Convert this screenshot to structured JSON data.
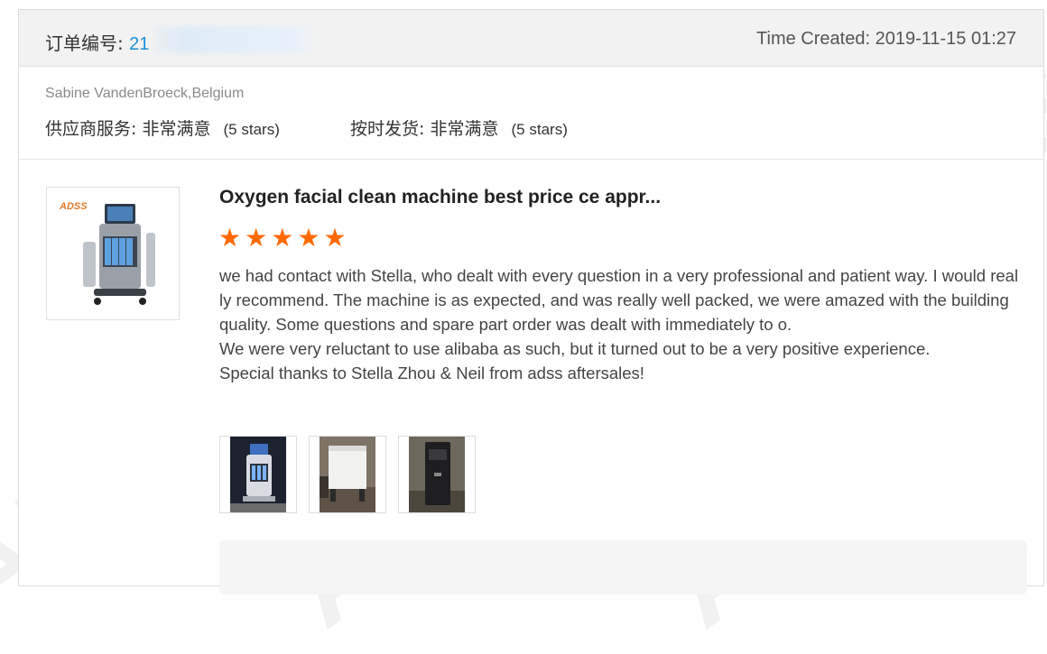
{
  "header": {
    "order_label": "订单编号:",
    "order_number": "21",
    "time_created": "Time Created: 2019-11-15 01:27"
  },
  "buyer": {
    "name": "Sabine VandenBroeck,Belgium"
  },
  "ratings": [
    {
      "label": "供应商服务:",
      "value": "非常满意",
      "stars_text": "(5 stars)"
    },
    {
      "label": "按时发货:",
      "value": "非常满意",
      "stars_text": "(5 stars)"
    }
  ],
  "product": {
    "title": "Oxygen facial clean machine best price ce appr...",
    "rating": 5
  },
  "review": {
    "lines": [
      "we had contact with Stella, who dealt with every question in a very professional and patient way. I would really recommend. The machine is as expected, and was really well packed, we were amazed with the building quality. Some questions and spare part order was dealt with immediately to o.",
      "We were very reluctant to use alibaba as such, but it turned out to be a very positive experience.",
      "Special thanks to Stella Zhou & Neil from adss aftersales!"
    ]
  },
  "photos": [
    "review-photo-machine",
    "review-photo-box",
    "review-photo-packaging"
  ],
  "watermark": "ADSS",
  "colors": {
    "accent_blue": "#1a8fd6",
    "star_orange": "#ff6a00",
    "header_bg": "#f2f2f2"
  }
}
